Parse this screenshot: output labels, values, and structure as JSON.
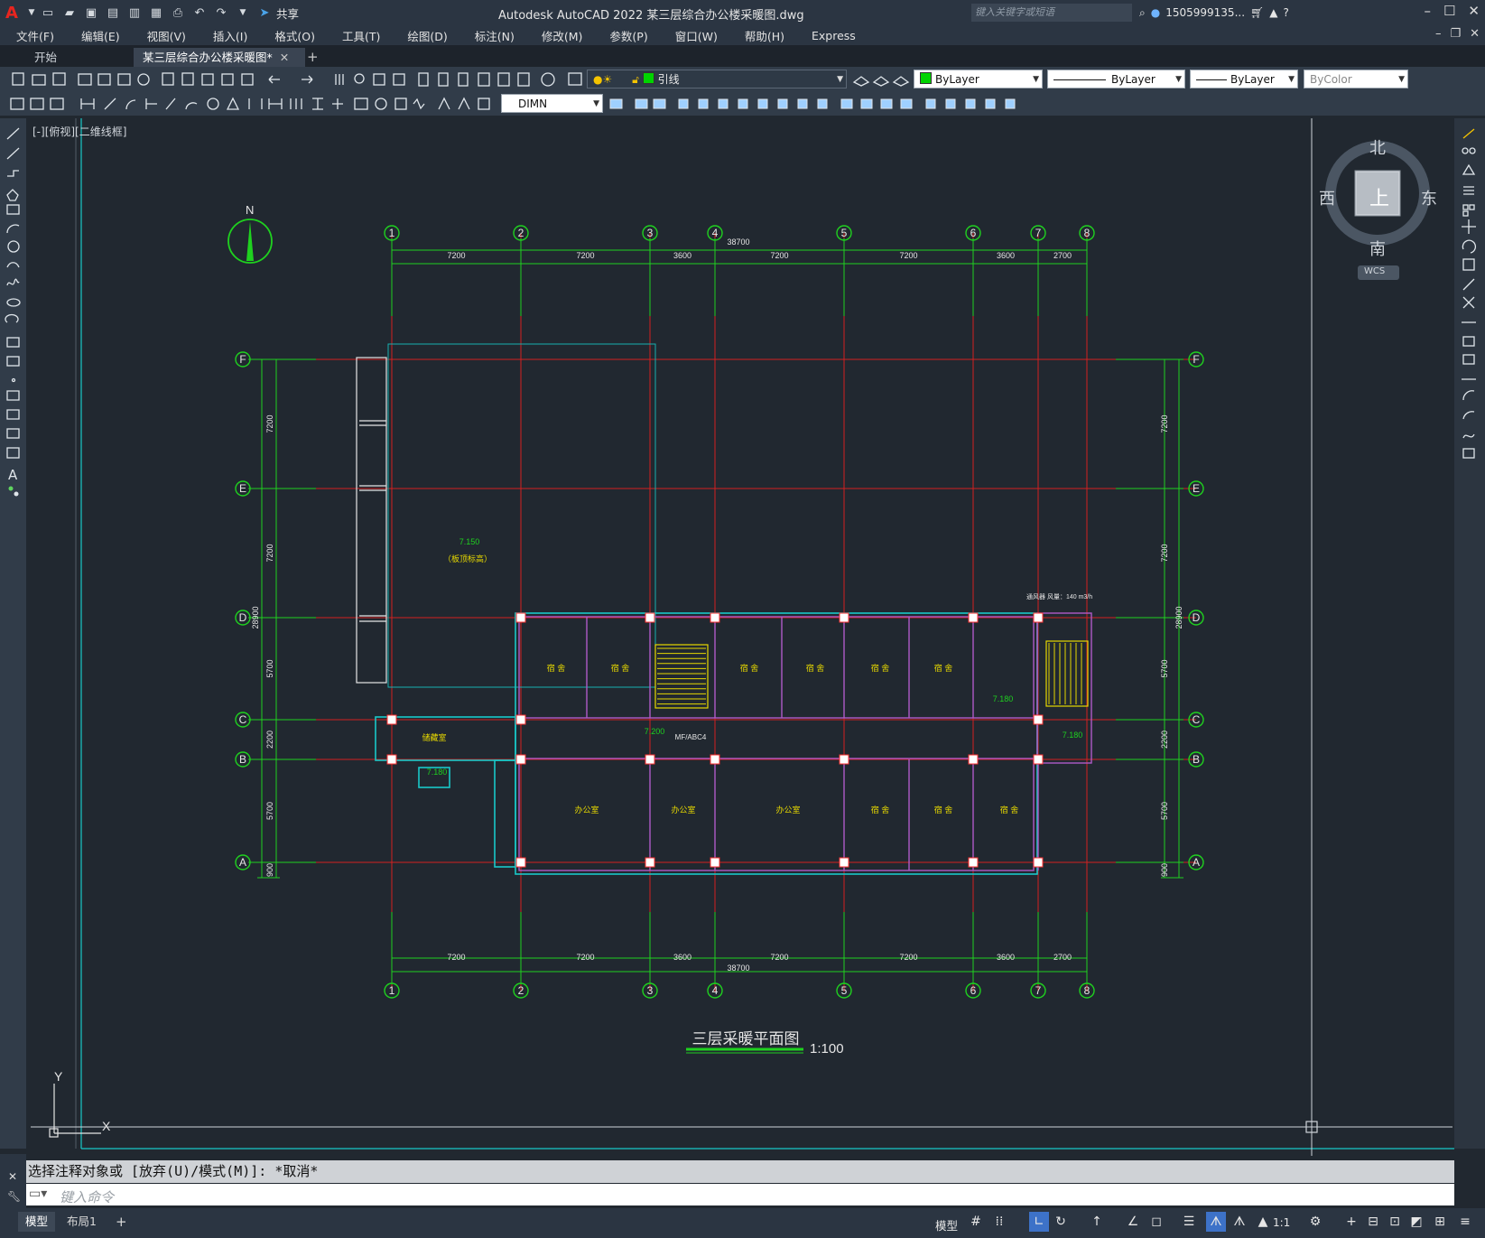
{
  "app": {
    "title": "Autodesk AutoCAD 2022    某三层综合办公楼采暖图.dwg",
    "share_label": "共享",
    "search_placeholder": "键入关键字或短语",
    "user": "1505999135..."
  },
  "menu": [
    "文件(F)",
    "编辑(E)",
    "视图(V)",
    "插入(I)",
    "格式(O)",
    "工具(T)",
    "绘图(D)",
    "标注(N)",
    "修改(M)",
    "参数(P)",
    "窗口(W)",
    "帮助(H)",
    "Express"
  ],
  "tabs": {
    "start": "开始",
    "document": "某三层综合办公楼采暖图*",
    "add": "+"
  },
  "toolbar": {
    "layer": "引线",
    "color": "ByLayer",
    "linetype": "ByLayer",
    "lineweight": "ByLayer",
    "plotstyle": "ByColor",
    "dimstyle": "DIMN"
  },
  "viewport_label": "[-][俯视][二维线框]",
  "viewcube": {
    "north": "北",
    "south": "南",
    "east": "东",
    "west": "西",
    "top": "上",
    "wcs": "WCS"
  },
  "drawing": {
    "north_label": "N",
    "axes_x": [
      "1",
      "2",
      "3",
      "4",
      "5",
      "6",
      "7",
      "8"
    ],
    "axes_y": [
      "F",
      "E",
      "D",
      "C",
      "B",
      "A"
    ],
    "dims_top": [
      "7200",
      "7200",
      "3600",
      "7200",
      "7200",
      "3600",
      "2700"
    ],
    "total_x": "38700",
    "dims_side": [
      "7200",
      "7200",
      "5700",
      "2200",
      "5700",
      "900"
    ],
    "total_y": "28900",
    "roof_level": "7.150",
    "roof_note": "（板顶标高）",
    "room_dorm": "宿 舍",
    "room_office": "办公室",
    "room_storage": "储藏室",
    "level_a": "7.200",
    "level_b": "7.180",
    "riser_label": "MF/ABC4",
    "vent_note": "通风器 风量：140 m3/h",
    "title": "三层采暖平面图",
    "scale": "1:100",
    "ucs_x": "X",
    "ucs_y": "Y"
  },
  "command": {
    "history": "选择注释对象或 [放弃(U)/模式(M)]: *取消*",
    "placeholder": "键入命令"
  },
  "status": {
    "tab_model": "模型",
    "tab_layout": "布局1",
    "tab_add": "+",
    "model_label": "模型",
    "scale_label": "1:1"
  }
}
